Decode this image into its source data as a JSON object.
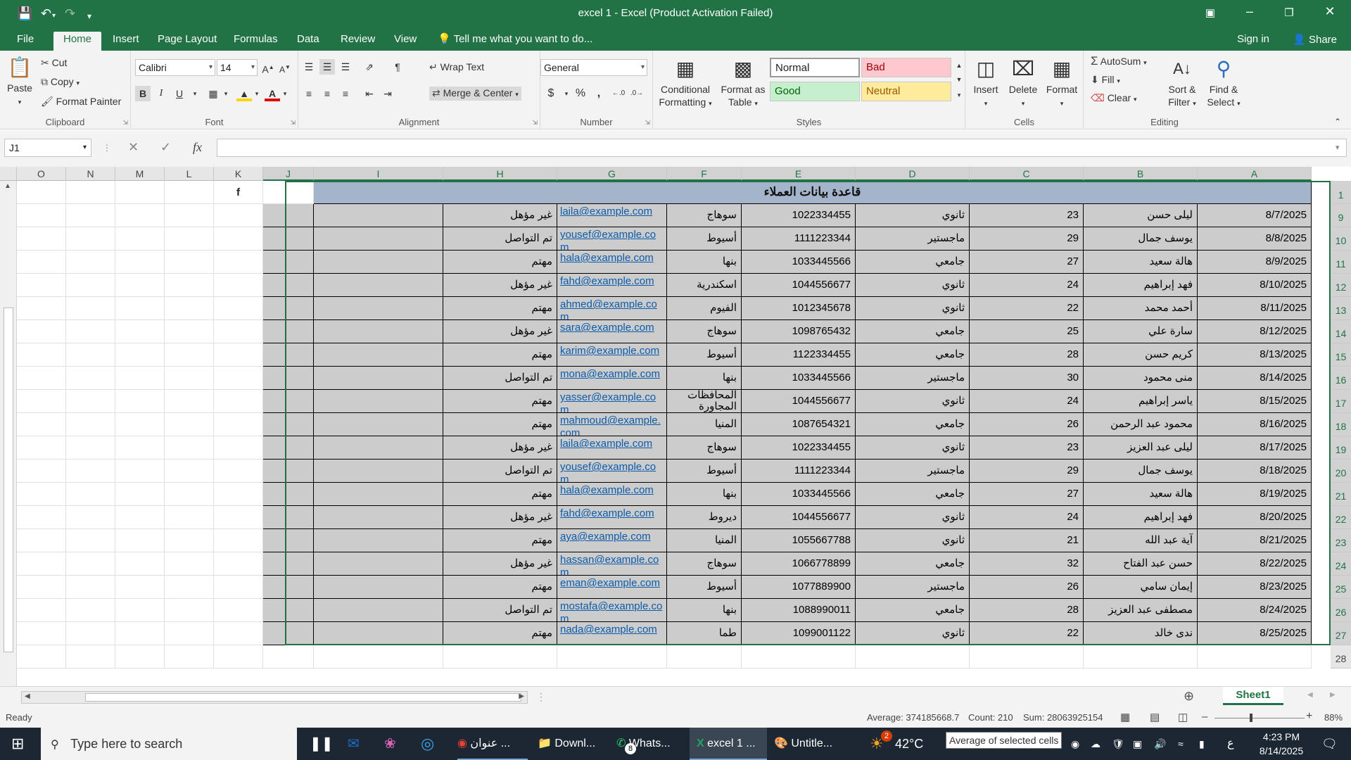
{
  "window": {
    "title": "excel 1 - Excel (Product Activation Failed)"
  },
  "menu": {
    "tabs": [
      "File",
      "Home",
      "Insert",
      "Page Layout",
      "Formulas",
      "Data",
      "Review",
      "View"
    ],
    "tell_me": "Tell me what you want to do...",
    "sign_in": "Sign in",
    "share": "Share"
  },
  "ribbon": {
    "clipboard": {
      "label": "Clipboard",
      "paste": "Paste",
      "cut": "Cut",
      "copy": "Copy",
      "format_painter": "Format Painter"
    },
    "font": {
      "label": "Font",
      "name": "Calibri",
      "size": "14"
    },
    "alignment": {
      "label": "Alignment",
      "wrap_text": "Wrap Text",
      "merge_center": "Merge & Center"
    },
    "number": {
      "label": "Number",
      "format": "General",
      "currency": "$",
      "percent": "%",
      "comma": ","
    },
    "styles": {
      "label": "Styles",
      "conditional": "Conditional",
      "formatting": "Formatting",
      "format_as": "Format as",
      "table": "Table",
      "normal": "Normal",
      "bad": "Bad",
      "good": "Good",
      "neutral": "Neutral"
    },
    "cells": {
      "label": "Cells",
      "insert": "Insert",
      "delete": "Delete",
      "format": "Format"
    },
    "editing": {
      "label": "Editing",
      "autosum": "AutoSum",
      "fill": "Fill",
      "clear": "Clear",
      "sort": "Sort &",
      "filter": "Filter",
      "find": "Find &",
      "select": "Select"
    }
  },
  "formula_bar": {
    "name_box": "J1",
    "fx": "fx",
    "value": ""
  },
  "sheet": {
    "columns": [
      "A",
      "B",
      "C",
      "D",
      "E",
      "F",
      "G",
      "H",
      "I",
      "J",
      "K",
      "L",
      "M",
      "N",
      "O"
    ],
    "title": "قاعدة بيانات العملاء",
    "k1": "f",
    "row_numbers": [
      "1",
      "9",
      "10",
      "11",
      "12",
      "13",
      "14",
      "15",
      "16",
      "17",
      "18",
      "19",
      "20",
      "21",
      "22",
      "23",
      "24",
      "25",
      "26",
      "27",
      "28"
    ],
    "rows": [
      {
        "date": "8/7/2025",
        "name": "ليلى حسن",
        "age": "23",
        "edu": "ثانوي",
        "phone": "1022334455",
        "city": "سوهاج",
        "email": "laila@example.com",
        "status": "غير مؤهل"
      },
      {
        "date": "8/8/2025",
        "name": "يوسف جمال",
        "age": "29",
        "edu": "ماجستير",
        "phone": "1111223344",
        "city": "أسيوط",
        "email": "yousef@example.com",
        "status": "تم التواصل"
      },
      {
        "date": "8/9/2025",
        "name": "هالة سعيد",
        "age": "27",
        "edu": "جامعي",
        "phone": "1033445566",
        "city": "بنها",
        "email": "hala@example.com",
        "status": "مهتم"
      },
      {
        "date": "8/10/2025",
        "name": "فهد إبراهيم",
        "age": "24",
        "edu": "ثانوي",
        "phone": "1044556677",
        "city": "اسكندرية",
        "email": "fahd@example.com",
        "status": "غير مؤهل"
      },
      {
        "date": "8/11/2025",
        "name": "أحمد محمد",
        "age": "22",
        "edu": "ثانوي",
        "phone": "1012345678",
        "city": "الفيوم",
        "email": "ahmed@example.com",
        "status": "مهتم"
      },
      {
        "date": "8/12/2025",
        "name": "سارة علي",
        "age": "25",
        "edu": "جامعي",
        "phone": "1098765432",
        "city": "سوهاج",
        "email": "sara@example.com",
        "status": "غير مؤهل"
      },
      {
        "date": "8/13/2025",
        "name": "كريم حسن",
        "age": "28",
        "edu": "جامعي",
        "phone": "1122334455",
        "city": "أسيوط",
        "email": "karim@example.com",
        "status": "مهتم"
      },
      {
        "date": "8/14/2025",
        "name": "منى محمود",
        "age": "30",
        "edu": "ماجستير",
        "phone": "1033445566",
        "city": "بنها",
        "email": "mona@example.com",
        "status": "تم التواصل"
      },
      {
        "date": "8/15/2025",
        "name": "ياسر إبراهيم",
        "age": "24",
        "edu": "ثانوي",
        "phone": "1044556677",
        "city": "المحافظات المجاورة",
        "email": "yasser@example.com",
        "status": "مهتم"
      },
      {
        "date": "8/16/2025",
        "name": "محمود عبد الرحمن",
        "age": "26",
        "edu": "جامعي",
        "phone": "1087654321",
        "city": "المنيا",
        "email": "mahmoud@example.com",
        "status": "مهتم"
      },
      {
        "date": "8/17/2025",
        "name": "ليلى عبد العزيز",
        "age": "23",
        "edu": "ثانوي",
        "phone": "1022334455",
        "city": "سوهاج",
        "email": "laila@example.com",
        "status": "غير مؤهل"
      },
      {
        "date": "8/18/2025",
        "name": "يوسف جمال",
        "age": "29",
        "edu": "ماجستير",
        "phone": "1111223344",
        "city": "أسيوط",
        "email": "yousef@example.com",
        "status": "تم التواصل"
      },
      {
        "date": "8/19/2025",
        "name": "هالة سعيد",
        "age": "27",
        "edu": "جامعي",
        "phone": "1033445566",
        "city": "بنها",
        "email": "hala@example.com",
        "status": "مهتم"
      },
      {
        "date": "8/20/2025",
        "name": "فهد إبراهيم",
        "age": "24",
        "edu": "ثانوي",
        "phone": "1044556677",
        "city": "ديروط",
        "email": "fahd@example.com",
        "status": "غير مؤهل"
      },
      {
        "date": "8/21/2025",
        "name": "آية عبد الله",
        "age": "21",
        "edu": "ثانوي",
        "phone": "1055667788",
        "city": "المنيا",
        "email": "aya@example.com",
        "status": "مهتم"
      },
      {
        "date": "8/22/2025",
        "name": "حسن عبد الفتاح",
        "age": "32",
        "edu": "جامعي",
        "phone": "1066778899",
        "city": "سوهاج",
        "email": "hassan@example.com",
        "status": "غير مؤهل"
      },
      {
        "date": "8/23/2025",
        "name": "إيمان سامي",
        "age": "26",
        "edu": "ماجستير",
        "phone": "1077889900",
        "city": "أسيوط",
        "email": "eman@example.com",
        "status": "مهتم"
      },
      {
        "date": "8/24/2025",
        "name": "مصطفى عبد العزيز",
        "age": "28",
        "edu": "جامعي",
        "phone": "1088990011",
        "city": "بنها",
        "email": "mostafa@example.com",
        "status": "تم التواصل"
      },
      {
        "date": "8/25/2025",
        "name": "ندى خالد",
        "age": "22",
        "edu": "ثانوي",
        "phone": "1099001122",
        "city": "طما",
        "email": "nada@example.com",
        "status": "مهتم"
      }
    ]
  },
  "sheet_tabs": {
    "active": "Sheet1"
  },
  "status": {
    "ready": "Ready",
    "average": "Average: 374185668.7",
    "count": "Count: 210",
    "sum": "Sum: 28063925154",
    "zoom": "88%"
  },
  "taskbar": {
    "search": "Type here to search",
    "chrome": "عنوان ...",
    "downloads": "Downl...",
    "whatsapp": "Whats...",
    "whatsapp_badge": "8",
    "excel": "excel 1 ...",
    "paint": "Untitle...",
    "weather_badge": "2",
    "temp": "42°C",
    "tooltip": "Average of selected cells",
    "lang": "ع",
    "time": "4:23 PM",
    "date": "8/14/2025"
  }
}
